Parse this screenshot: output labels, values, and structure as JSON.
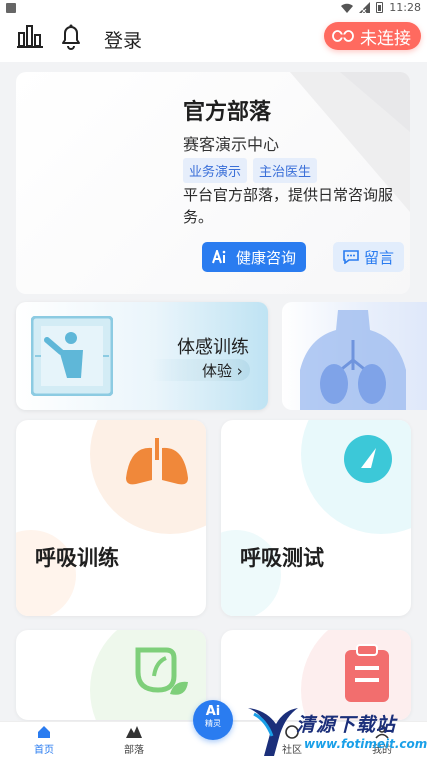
{
  "status_bar": {
    "time": "11:28"
  },
  "top_bar": {
    "login_label": "登录",
    "connection_status": "未连接",
    "colors": {
      "connection": "#ff6a5f"
    }
  },
  "tribe_card": {
    "title": "官方部落",
    "subtitle": "赛客演示中心",
    "tags": [
      "业务演示",
      "主治医生"
    ],
    "description": "平台官方部落，提供日常咨询服务。",
    "health_button": "健康咨询",
    "message_button": "留言"
  },
  "motion_card": {
    "title": "体感训练",
    "action": "体验"
  },
  "feature_cards": [
    {
      "label": "呼吸训练",
      "icon": "lungs-icon",
      "accent": "#f0883a"
    },
    {
      "label": "呼吸测试",
      "icon": "gauge-icon",
      "accent": "#3cc8d8"
    },
    {
      "label": "",
      "icon": "leaf-icon",
      "accent": "#7ecf7a"
    },
    {
      "label": "",
      "icon": "clipboard-icon",
      "accent": "#f26e6e"
    }
  ],
  "bottom_nav": {
    "items": [
      {
        "label": "首页",
        "icon": "home-icon"
      },
      {
        "label": "部落",
        "icon": "mountain-icon"
      },
      {
        "label": "社区",
        "icon": "community-icon"
      },
      {
        "label": "我的",
        "icon": "profile-icon"
      }
    ],
    "ai_button": {
      "main": "Ai",
      "sub": "精灵"
    }
  },
  "watermark": {
    "title": "清源下载站",
    "url": "www.fotimeit.com"
  }
}
